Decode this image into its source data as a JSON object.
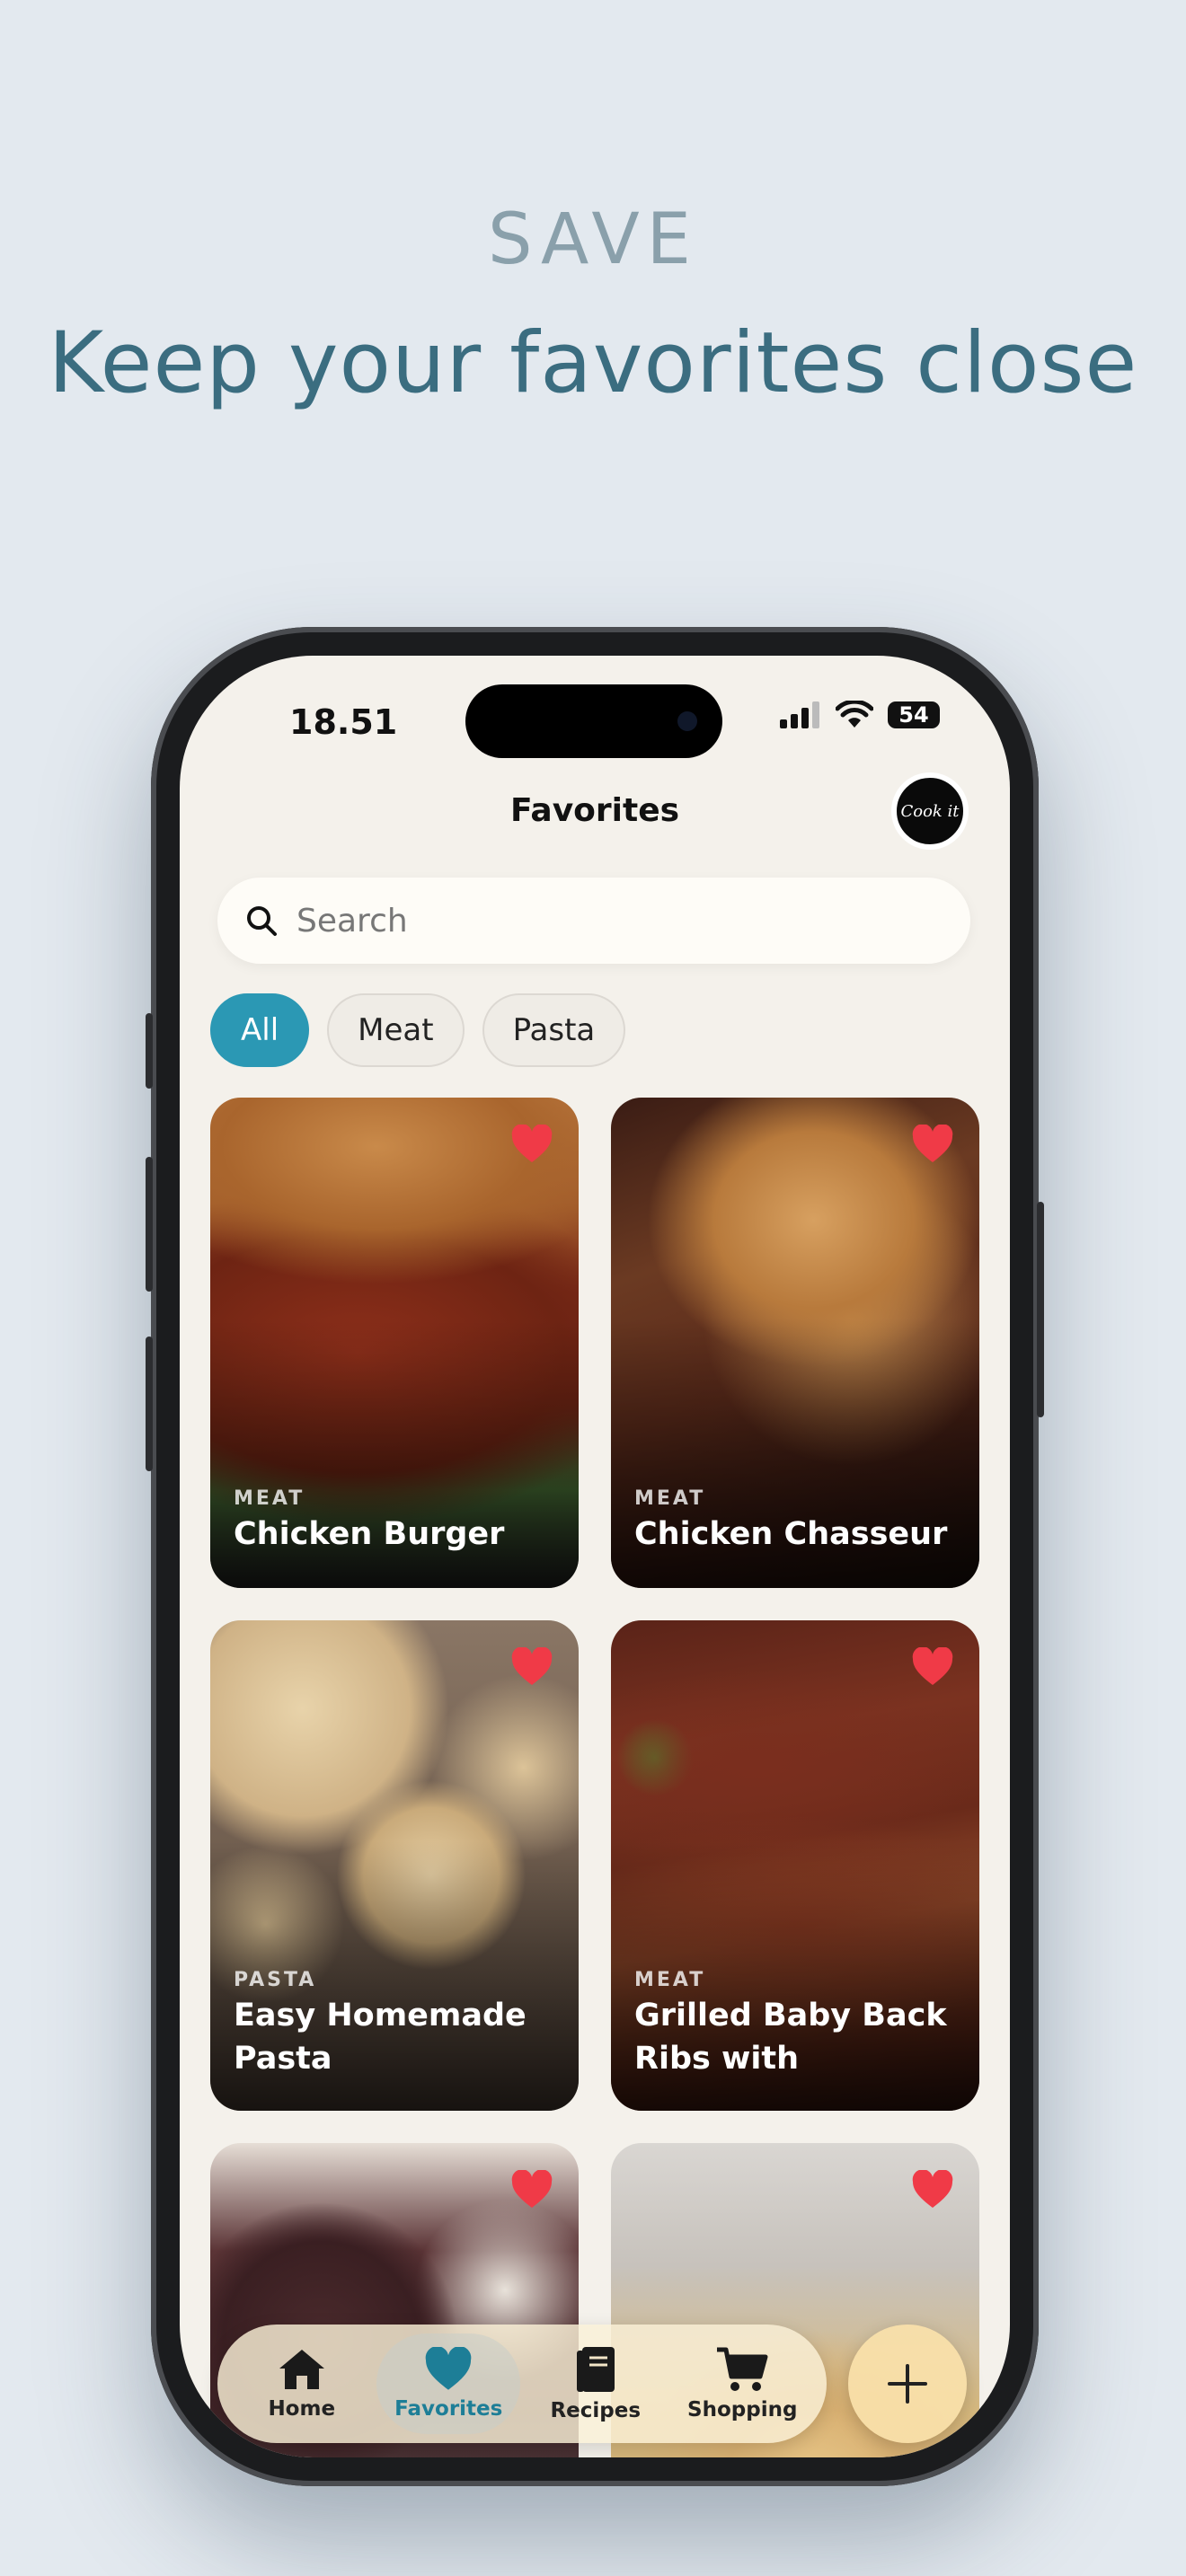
{
  "marketing": {
    "eyebrow": "SAVE",
    "headline": "Keep your favorites close"
  },
  "status_bar": {
    "time": "18.51",
    "battery": "54"
  },
  "header": {
    "title": "Favorites",
    "avatar_text": "Cook it"
  },
  "search": {
    "placeholder": "Search"
  },
  "filters": [
    "All",
    "Meat",
    "Pasta"
  ],
  "active_filter": "All",
  "recipes": [
    {
      "category": "MEAT",
      "name": "Chicken Burger",
      "favorite": true
    },
    {
      "category": "MEAT",
      "name": "Chicken Chasseur",
      "favorite": true
    },
    {
      "category": "PASTA",
      "name": "Easy Homemade Pasta",
      "favorite": true
    },
    {
      "category": "MEAT",
      "name": "Grilled Baby Back Ribs with Rosemar…",
      "favorite": true
    },
    {
      "category": "",
      "name": "",
      "favorite": true
    },
    {
      "category": "",
      "name": "",
      "favorite": true
    }
  ],
  "tabbar": {
    "home": "Home",
    "favorites": "Favorites",
    "recipes": "Recipes",
    "shopping": "Shopping"
  },
  "colors": {
    "accent": "#2b98b4",
    "heart": "#f03a47",
    "headline": "#3b6d80"
  },
  "icons": {
    "search": "search-icon",
    "heart": "heart-icon",
    "home": "home-icon",
    "recipes": "book-icon",
    "shopping": "cart-icon",
    "add": "plus-icon"
  }
}
